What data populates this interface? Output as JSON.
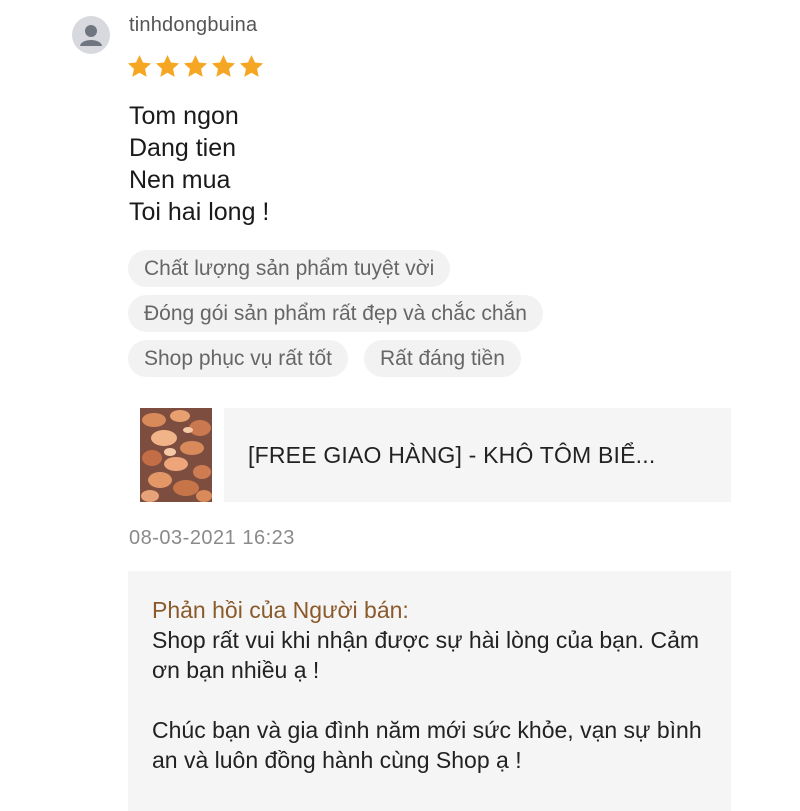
{
  "review": {
    "username": "tinhdongbuina",
    "rating": 5,
    "rating_max": 5,
    "star_color": "#f5a623",
    "text_lines": [
      "Tom ngon",
      "Dang tien",
      "Nen mua",
      "Toi hai long !"
    ],
    "tags": [
      [
        "Chất lượng sản phẩm tuyệt vời"
      ],
      [
        "Đóng gói sản phẩm rất đẹp và chắc chắn"
      ],
      [
        "Shop phục vụ rất tốt",
        "Rất đáng tiền"
      ]
    ],
    "product_title": "[FREE GIAO HÀNG] - KHÔ TÔM BIỂ...",
    "timestamp": "08-03-2021 16:23"
  },
  "seller_reply": {
    "title": "Phản hồi của Người bán:",
    "title_color": "#8a5a2b",
    "paragraph_1": "Shop rất vui khi nhận được sự hài lòng của bạn. Cảm ơn bạn nhiều ạ !",
    "paragraph_2": "Chúc bạn và gia đình năm mới sức khỏe, vạn sự bình an và luôn đồng hành cùng Shop ạ !"
  },
  "icons": {
    "avatar": "user-avatar-icon",
    "star": "star-icon"
  }
}
